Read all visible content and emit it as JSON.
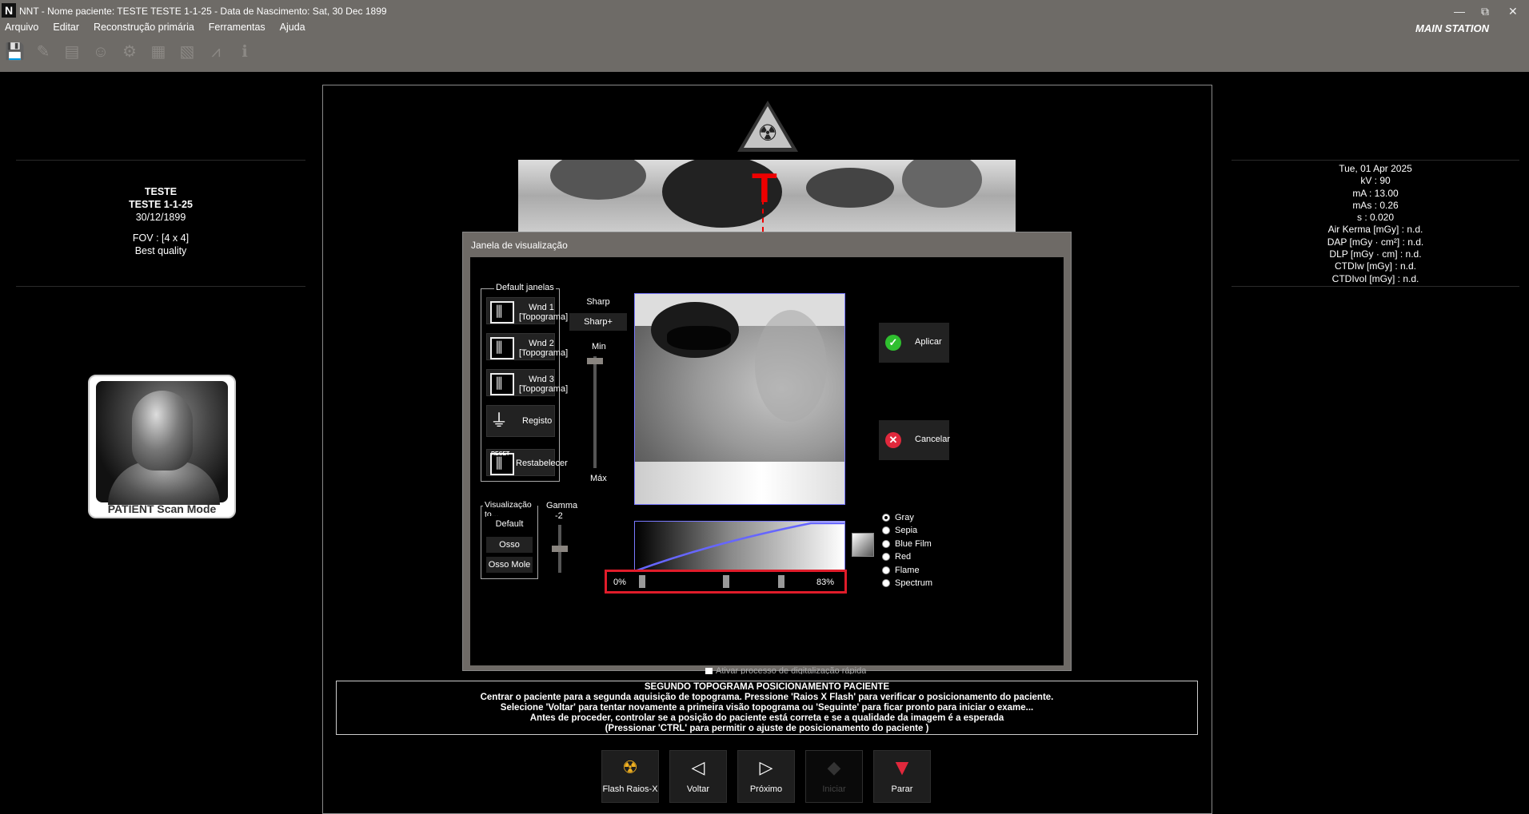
{
  "window": {
    "title": "NNT - Nome paciente: TESTE TESTE 1-1-25 - Data de Nascimento: Sat, 30 Dec 1899",
    "logo": "N",
    "station": "MAIN STATION",
    "controls": {
      "minimize": "—",
      "restore": "⧉",
      "close": "✕"
    }
  },
  "menu": [
    "Arquivo",
    "Editar",
    "Reconstrução primária",
    "Ferramentas",
    "Ajuda"
  ],
  "toolbar_icons": [
    "save-icon",
    "edit-document-icon",
    "folder-icon",
    "user-icon",
    "settings-icon",
    "database-icon",
    "patient-icon",
    "chart-icon",
    "info-icon"
  ],
  "patient": {
    "name1": "TESTE",
    "name2": "TESTE 1-1-25",
    "dob": "30/12/1899",
    "fov": "FOV : [4 x 4]",
    "quality": "Best quality",
    "mode_label": "PATIENT Scan Mode"
  },
  "exposure": {
    "date": "Tue, 01 Apr 2025",
    "kv": "kV : 90",
    "ma": "mA : 13.00",
    "mas": "mAs : 0.26",
    "s": "s : 0.020",
    "air_kerma": "Air Kerma [mGy] : n.d.",
    "dap": "DAP [mGy · cm²] : n.d.",
    "dlp": "DLP [mGy · cm] : n.d.",
    "ctdiw": "CTDIw [mGy] : n.d.",
    "ctdivol": "CTDIvol [mGy] : n.d."
  },
  "topogram_marker": "T",
  "dialog": {
    "title": "Janela de visualização",
    "default_group": "Default janelas",
    "wnd1": {
      "line1": "Wnd 1",
      "line2": "[Topograma]"
    },
    "wnd2": {
      "line1": "Wnd 2",
      "line2": "[Topograma]"
    },
    "wnd3": {
      "line1": "Wnd 3",
      "line2": "[Topograma]"
    },
    "registo": "Registo",
    "reset_badge": "RESET",
    "restabelecer": "Restabelecer",
    "sharp": "Sharp",
    "sharp_plus": "Sharp+",
    "min": "Min",
    "max": "Máx",
    "visualizacao_group": "Visualização to...",
    "vis_default": "Default",
    "vis_osso": "Osso",
    "vis_osso_mole": "Osso Mole",
    "gamma_label": "Gamma",
    "gamma_value": "-2",
    "apply": "Aplicar",
    "cancel": "Cancelar",
    "range_min": "0%",
    "range_max": "83%",
    "range_min_frac": 0,
    "range_mid_frac": 0.5,
    "range_max_frac": 0.83,
    "colormaps": [
      "Gray",
      "Sepia",
      "Blue Film",
      "Red",
      "Flame",
      "Spectrum"
    ],
    "selected_colormap": "Gray",
    "hidden_checkbox": "Ativar processo de digitalização rápida"
  },
  "message": {
    "line1": "SEGUNDO TOPOGRAMA POSICIONAMENTO PACIENTE",
    "line2": "Centrar o paciente para a segunda aquisição de topograma. Pressione 'Raios X Flash' para verificar o posicionamento do paciente.",
    "line3": "Selecione 'Voltar' para tentar novamente a primeira visão topograma ou 'Seguinte' para ficar pronto para iniciar o exame...",
    "line4": "Antes de proceder, controlar se a posição do paciente está correta e se a qualidade da imagem é a esperada",
    "line5": "(Pressionar 'CTRL' para permitir o ajuste de posicionamento do paciente )"
  },
  "bottom_buttons": {
    "flash": "Flash Raios-X",
    "voltar": "Voltar",
    "proximo": "Próximo",
    "iniciar": "Iniciar",
    "parar": "Parar"
  },
  "colors": {
    "titlebar": "#6e6b67",
    "highlight": "#e01c2a",
    "apply_green": "#2fbf2f",
    "cancel_red": "#e0283c",
    "curve": "#6666ff"
  }
}
